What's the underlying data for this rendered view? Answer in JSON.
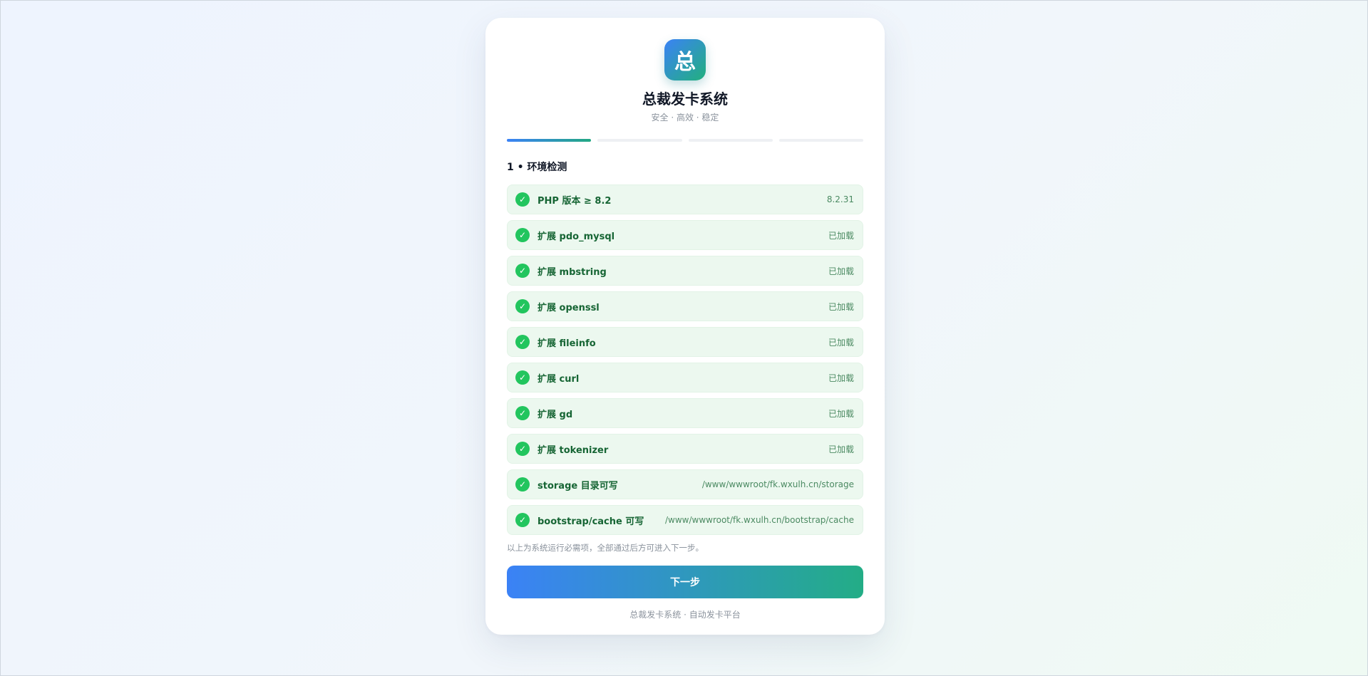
{
  "brand": {
    "logo_char": "总",
    "title": "总裁发卡系统",
    "subtitle": "安全 · 高效 · 稳定"
  },
  "steps": {
    "total": 4,
    "current": 1
  },
  "section": {
    "title": "1 • 环境检测"
  },
  "checks": [
    {
      "label": "PHP 版本 ≥ 8.2",
      "value": "8.2.31",
      "status": "pass"
    },
    {
      "label": "扩展 pdo_mysql",
      "value": "已加载",
      "status": "pass"
    },
    {
      "label": "扩展 mbstring",
      "value": "已加载",
      "status": "pass"
    },
    {
      "label": "扩展 openssl",
      "value": "已加载",
      "status": "pass"
    },
    {
      "label": "扩展 fileinfo",
      "value": "已加载",
      "status": "pass"
    },
    {
      "label": "扩展 curl",
      "value": "已加载",
      "status": "pass"
    },
    {
      "label": "扩展 gd",
      "value": "已加载",
      "status": "pass"
    },
    {
      "label": "扩展 tokenizer",
      "value": "已加载",
      "status": "pass"
    },
    {
      "label": "storage 目录可写",
      "value": "/www/wwwroot/fk.wxulh.cn/storage",
      "status": "pass"
    },
    {
      "label": "bootstrap/cache 可写",
      "value": "/www/wwwroot/fk.wxulh.cn/bootstrap/cache",
      "status": "pass"
    }
  ],
  "icons": {
    "check": "check-circle-icon"
  },
  "note": "以上为系统运行必需项，全部通过后方可进入下一步。",
  "actions": {
    "next_label": "下一步"
  },
  "footer": "总裁发卡系统 · 自动发卡平台",
  "colors": {
    "accent_start": "#3b82f6",
    "accent_end": "#22b07d",
    "success": "#22c55e",
    "success_bg": "#ecf8ef"
  }
}
